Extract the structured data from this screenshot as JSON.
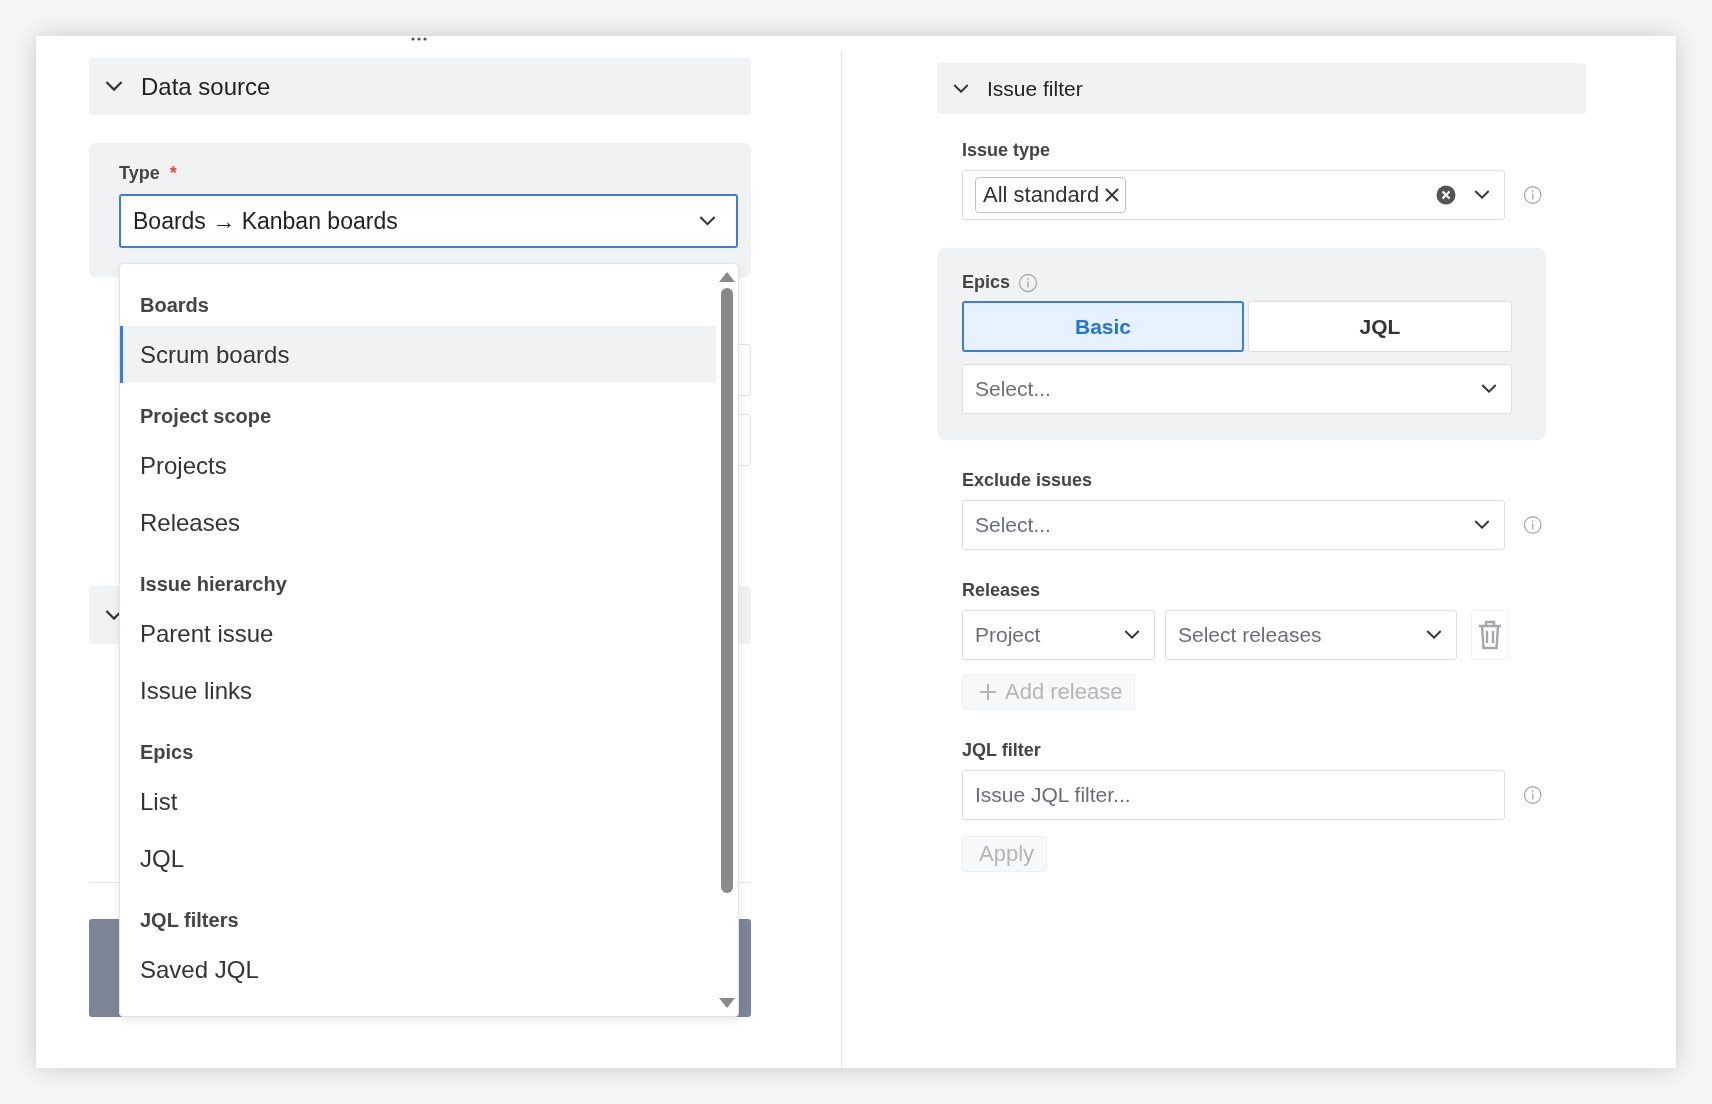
{
  "data_source": {
    "title": "Data source",
    "expanded": true,
    "type_field": {
      "label": "Type",
      "required_mark": "*",
      "value": "Boards → Kanban boards",
      "open": true
    },
    "type_menu": {
      "groups": [
        {
          "heading": "Boards",
          "options": [
            {
              "label": "Scrum boards",
              "selected": true
            }
          ]
        },
        {
          "heading": "Project scope",
          "options": [
            {
              "label": "Projects",
              "selected": false
            },
            {
              "label": "Releases",
              "selected": false
            }
          ]
        },
        {
          "heading": "Issue hierarchy",
          "options": [
            {
              "label": "Parent issue",
              "selected": false
            },
            {
              "label": "Issue links",
              "selected": false
            }
          ]
        },
        {
          "heading": "Epics",
          "options": [
            {
              "label": "List",
              "selected": false
            },
            {
              "label": "JQL",
              "selected": false
            }
          ]
        },
        {
          "heading": "JQL filters",
          "options": [
            {
              "label": "Saved JQL",
              "selected": false
            }
          ]
        }
      ]
    }
  },
  "issue_filter": {
    "title": "Issue filter",
    "expanded": true,
    "issue_type": {
      "label": "Issue type",
      "tags": [
        "All standard"
      ]
    },
    "epics": {
      "label": "Epics",
      "modes": [
        {
          "label": "Basic",
          "selected": true
        },
        {
          "label": "JQL",
          "selected": false
        }
      ],
      "placeholder": "Select..."
    },
    "exclude_issues": {
      "label": "Exclude issues",
      "placeholder": "Select..."
    },
    "releases": {
      "label": "Releases",
      "project": "Project",
      "releases_placeholder": "Select releases",
      "add_button": {
        "label": "Add release",
        "disabled": true
      }
    },
    "jql_filter": {
      "label": "JQL filter",
      "placeholder": "Issue JQL filter...",
      "apply_button": {
        "label": "Apply",
        "disabled": true
      }
    }
  }
}
